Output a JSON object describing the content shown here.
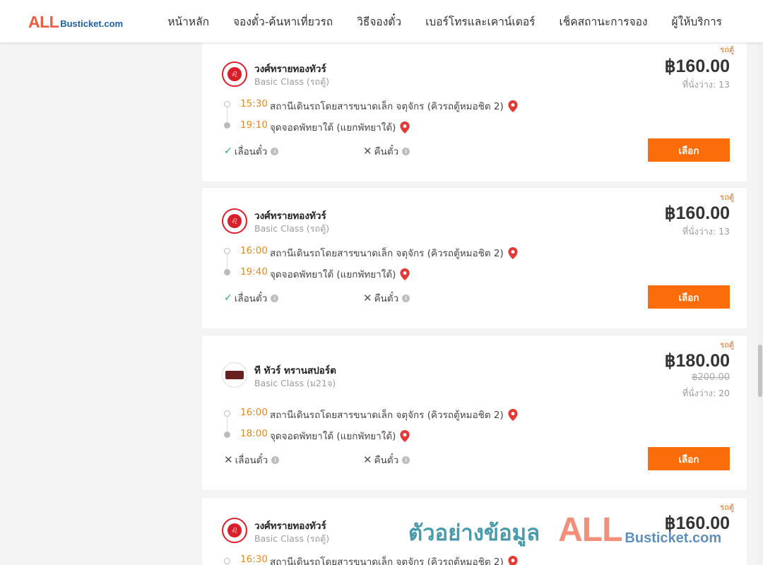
{
  "brand": {
    "logo_all": "ALL",
    "logo_rest": "Busticket.com"
  },
  "nav": [
    {
      "label": "หน้าหลัก"
    },
    {
      "label": "จองตั๋ว-ค้นหาเที่ยวรถ"
    },
    {
      "label": "วิธีจองตั๋ว"
    },
    {
      "label": "เบอร์โทรและเคาน์เตอร์"
    },
    {
      "label": "เช็คสถานะการจอง"
    },
    {
      "label": "ผู้ให้บริการ"
    }
  ],
  "trips": [
    {
      "badge": "รถตู้",
      "operator": "วงศ์ทรายทองทัวร์",
      "class": "Basic Class (รถตู้)",
      "price": "฿160.00",
      "seats": "ที่นั่งว่าง: 13",
      "depart_time": "15:30",
      "depart_stop": "สถานีเดินรถโดยสารขนาดเล็ก จตุจักร (คิวรถตู้หมอชิต 2)",
      "arrive_time": "19:10",
      "arrive_stop": "จุดจอดพัทยาใต้ (แยกพัทยาใต้)",
      "reschedule": "เลื่อนตั๋ว",
      "refund": "คืนตั๋ว",
      "select": "เลือก"
    },
    {
      "badge": "รถตู้",
      "operator": "วงศ์ทรายทองทัวร์",
      "class": "Basic Class (รถตู้)",
      "price": "฿160.00",
      "seats": "ที่นั่งว่าง: 13",
      "depart_time": "16:00",
      "depart_stop": "สถานีเดินรถโดยสารขนาดเล็ก จตุจักร (คิวรถตู้หมอชิต 2)",
      "arrive_time": "19:40",
      "arrive_stop": "จุดจอดพัทยาใต้ (แยกพัทยาใต้)",
      "reschedule": "เลื่อนตั๋ว",
      "refund": "คืนตั๋ว",
      "select": "เลือก"
    },
    {
      "badge": "รถตู้",
      "operator": "ที ทัวร์ ทรานสปอร์ต",
      "class": "Basic Class (ม21จ)",
      "price": "฿180.00",
      "old_price": "฿200.00",
      "seats": "ที่นั่งว่าง: 20",
      "depart_time": "16:00",
      "depart_stop": "สถานีเดินรถโดยสารขนาดเล็ก จตุจักร (คิวรถตู้หมอชิต 2)",
      "arrive_time": "18:00",
      "arrive_stop": "จุดจอดพัทยาใต้ (แยกพัทยาใต้)",
      "reschedule": "เลื่อนตั๋ว",
      "refund": "คืนตั๋ว",
      "select": "เลือก"
    },
    {
      "badge": "รถตู้",
      "operator": "วงศ์ทรายทองทัวร์",
      "class": "Basic Class (รถตู้)",
      "price": "฿160.00",
      "depart_time": "16:30",
      "depart_stop": "สถานีเดินรถโดยสารขนาดเล็ก จตุจักร (คิวรถตู้หมอชิต 2)"
    }
  ],
  "watermark": {
    "thai": "ตัวอย่างข้อมูล",
    "all": "ALL",
    "rest": "Busticket.com"
  },
  "icons": {
    "pin": "map-pin-icon",
    "check": "check-icon",
    "cross": "close-icon",
    "info": "info-icon"
  },
  "colors": {
    "accent": "#fb6d0a",
    "time": "#e58a1f",
    "check": "#2fa55c",
    "pin": "#e53935"
  }
}
